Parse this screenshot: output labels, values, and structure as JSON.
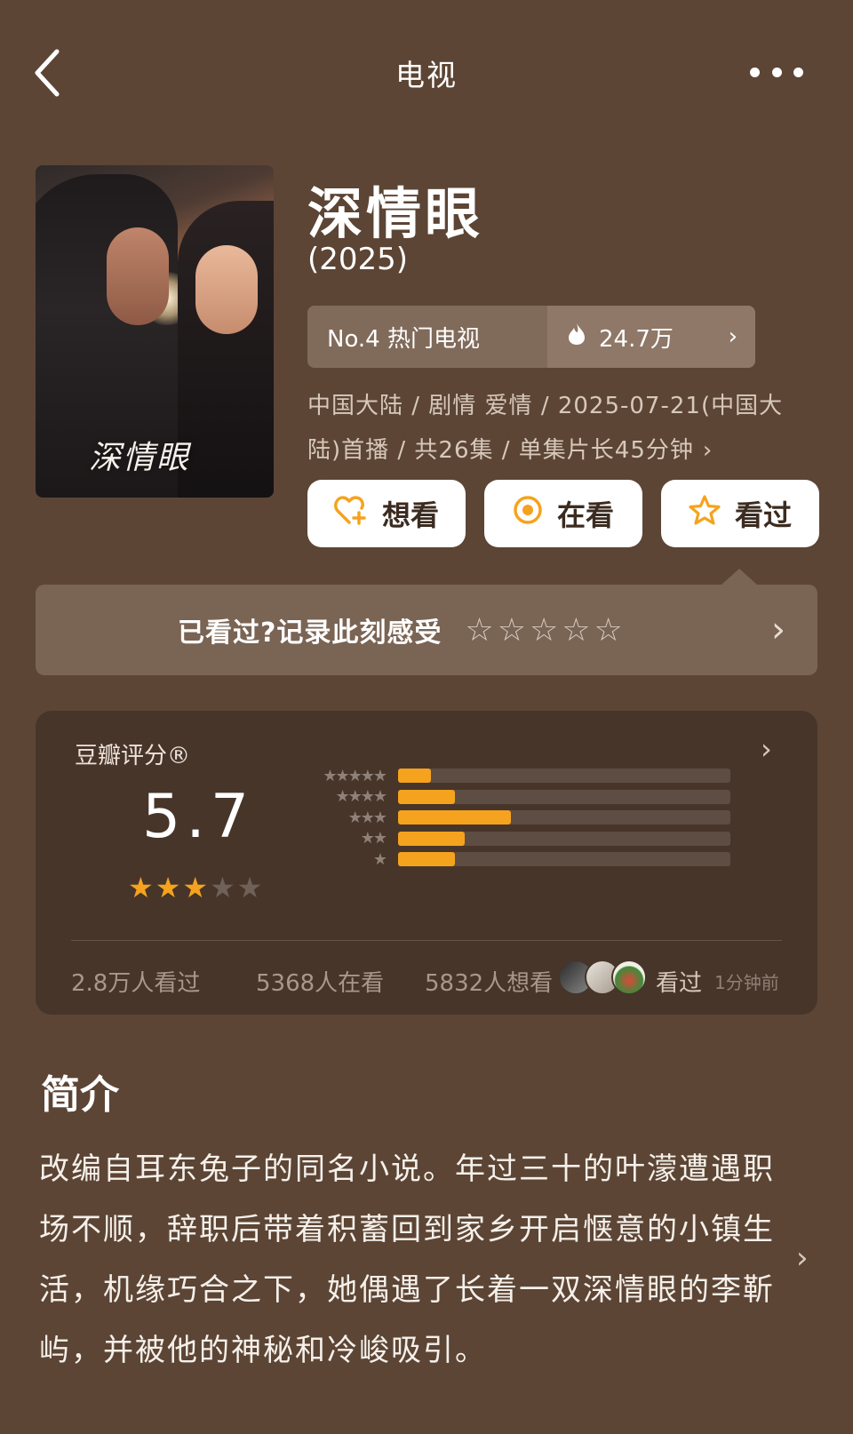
{
  "nav": {
    "title": "电视"
  },
  "poster": {
    "logo_text": "深情眼"
  },
  "movie": {
    "title": "深情眼",
    "year": "(2025)"
  },
  "rank": {
    "label": "No.4 热门电视",
    "heat": "24.7万"
  },
  "meta": {
    "text": "中国大陆 / 剧情 爱情 / 2025-07-21(中国大陆)首播 / 共26集 / 单集片长45分钟"
  },
  "actions": {
    "want": "想看",
    "watching": "在看",
    "watched": "看过"
  },
  "record": {
    "text": "已看过?记录此刻感受",
    "stars": 0
  },
  "rating": {
    "label": "豆瓣评分®",
    "score": "5.7",
    "stars_filled": 3,
    "stars_total": 5,
    "distribution": [
      {
        "stars": "★★★★★",
        "fraction": 0.1
      },
      {
        "stars": "★★★★",
        "fraction": 0.17
      },
      {
        "stars": "★★★",
        "fraction": 0.34
      },
      {
        "stars": "★★",
        "fraction": 0.2
      },
      {
        "stars": "★",
        "fraction": 0.17
      }
    ],
    "watched_count": "2.8万人看过",
    "watching_count": "5368人在看",
    "want_count": "5832人想看",
    "recent_label": "看过",
    "recent_time": "1分钟前"
  },
  "intro": {
    "title": "简介",
    "text": "改编自耳东兔子的同名小说。年过三十的叶濛遭遇职场不顺，辞职后带着积蓄回到家乡开启惬意的小镇生活，机缘巧合之下，她偶遇了长着一双深情眼的李靳屿，并被他的神秘和冷峻吸引。"
  },
  "colors": {
    "background": "#5c4535",
    "card": "#47352a",
    "accent": "#f5a31e"
  },
  "icons": {
    "back": "chevron-left-icon",
    "more": "more-dots-icon",
    "fire": "fire-icon",
    "heart_plus": "heart-plus-icon",
    "watching": "target-circle-icon",
    "star": "star-icon"
  }
}
